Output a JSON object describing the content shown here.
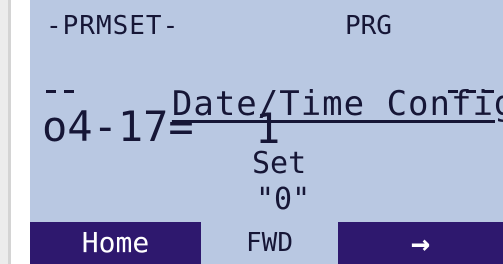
{
  "header": {
    "mode": "-PRMSET-",
    "status": "PRG"
  },
  "screen": {
    "title": "Date/Time Config",
    "parameter_code": "o4-17=",
    "parameter_value": "1",
    "setting_label": "Set",
    "setting_value": "\"0\""
  },
  "softkeys": {
    "left": "Home",
    "middle": "FWD",
    "right": "→"
  },
  "colors": {
    "lcd_background": "#b9c8e2",
    "lcd_text": "#161636",
    "softkey_background": "#2e186e",
    "softkey_text": "#ffffff"
  }
}
